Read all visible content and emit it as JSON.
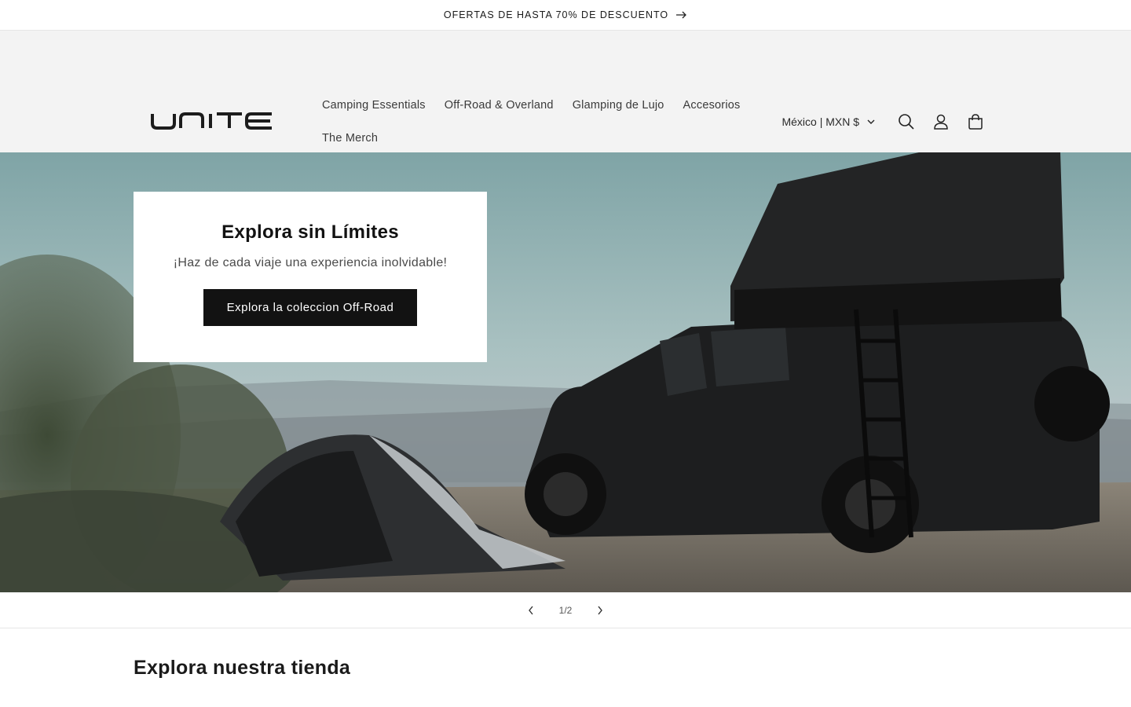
{
  "announcement": {
    "text": "OFERTAS DE HASTA 70% DE DESCUENTO"
  },
  "header": {
    "logo_text": "UNITE",
    "nav": [
      "Camping Essentials",
      "Off-Road & Overland",
      "Glamping de Lujo",
      "Accesorios",
      "The Merch"
    ],
    "locale": "México | MXN $",
    "icons": [
      "search-icon",
      "account-icon",
      "cart-icon"
    ]
  },
  "hero": {
    "title": "Explora sin Límites",
    "subtitle": "¡Haz de cada viaje una experiencia inolvidable!",
    "button": "Explora la coleccion Off-Road"
  },
  "slider": {
    "counter": "1/2"
  },
  "section": {
    "title": "Explora nuestra tienda"
  },
  "colors": {
    "header_bg": "#f3f3f3",
    "button_bg": "#121212",
    "text": "#121212"
  }
}
